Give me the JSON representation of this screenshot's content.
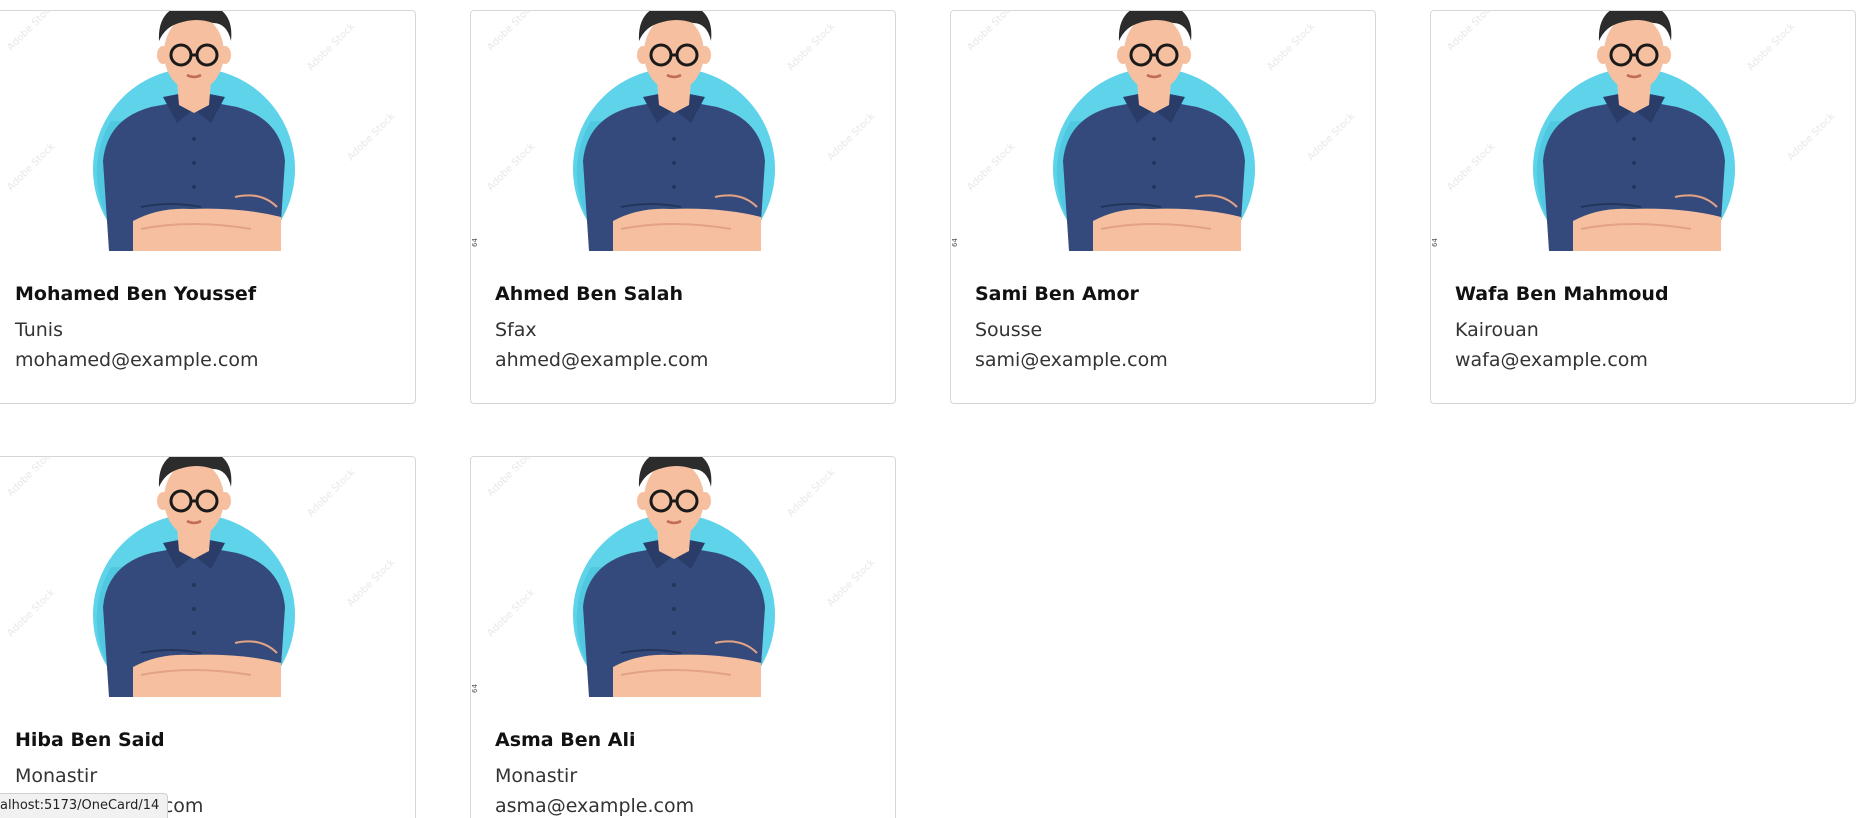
{
  "cards": [
    {
      "name": "Mohamed Ben Youssef",
      "city": "Tunis",
      "email": "mohamed@example.com"
    },
    {
      "name": "Ahmed Ben Salah",
      "city": "Sfax",
      "email": "ahmed@example.com"
    },
    {
      "name": "Sami Ben Amor",
      "city": "Sousse",
      "email": "sami@example.com"
    },
    {
      "name": "Wafa Ben Mahmoud",
      "city": "Kairouan",
      "email": "wafa@example.com"
    },
    {
      "name": "Hiba Ben Said",
      "city": "Monastir",
      "email": "hiba@example.com"
    },
    {
      "name": "Asma Ben Ali",
      "city": "Monastir",
      "email": "asma@example.com"
    }
  ],
  "status_bar": {
    "url": "alhost:5173/OneCard/14"
  },
  "avatar": {
    "watermark": "Adobe Stock",
    "tag": "64"
  },
  "colors": {
    "circle": "#5ed3ea",
    "shirt": "#354a7c",
    "skin": "#f6bfa0",
    "hair": "#2c2c2c",
    "card_border": "#d6d6d6"
  },
  "icons": {
    "avatar": "person-avatar-illustration"
  }
}
